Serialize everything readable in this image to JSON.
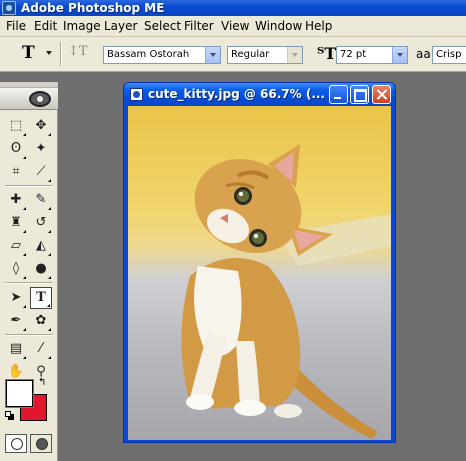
{
  "app": {
    "title": "Adobe Photoshop ME"
  },
  "menu": [
    "File",
    "Edit",
    "Image",
    "Layer",
    "Select",
    "Filter",
    "View",
    "Window",
    "Help"
  ],
  "options": {
    "tool_glyph": "T",
    "font_family": "Bassam Ostorah",
    "font_style": "Regular",
    "font_size": "72 pt",
    "antialias_glyph": "aa",
    "antialias": "Crisp"
  },
  "toolbox": {
    "tools": [
      "rectangular-marquee",
      "move",
      "lasso",
      "magic-wand",
      "crop",
      "slice",
      "healing-brush",
      "brush",
      "clone-stamp",
      "history-brush",
      "eraser",
      "paint-bucket",
      "blur",
      "dodge",
      "path-selection",
      "type",
      "pen",
      "custom-shape",
      "notes",
      "eyedropper",
      "hand",
      "zoom"
    ],
    "active_tool": "type",
    "foreground_color": "#ffffff",
    "background_color": "#e2162d"
  },
  "document": {
    "title": "cute_kitty.jpg @ 66.7% (...",
    "image_subject": "orange and white kitten sitting on grey carpet against yellow wall"
  }
}
